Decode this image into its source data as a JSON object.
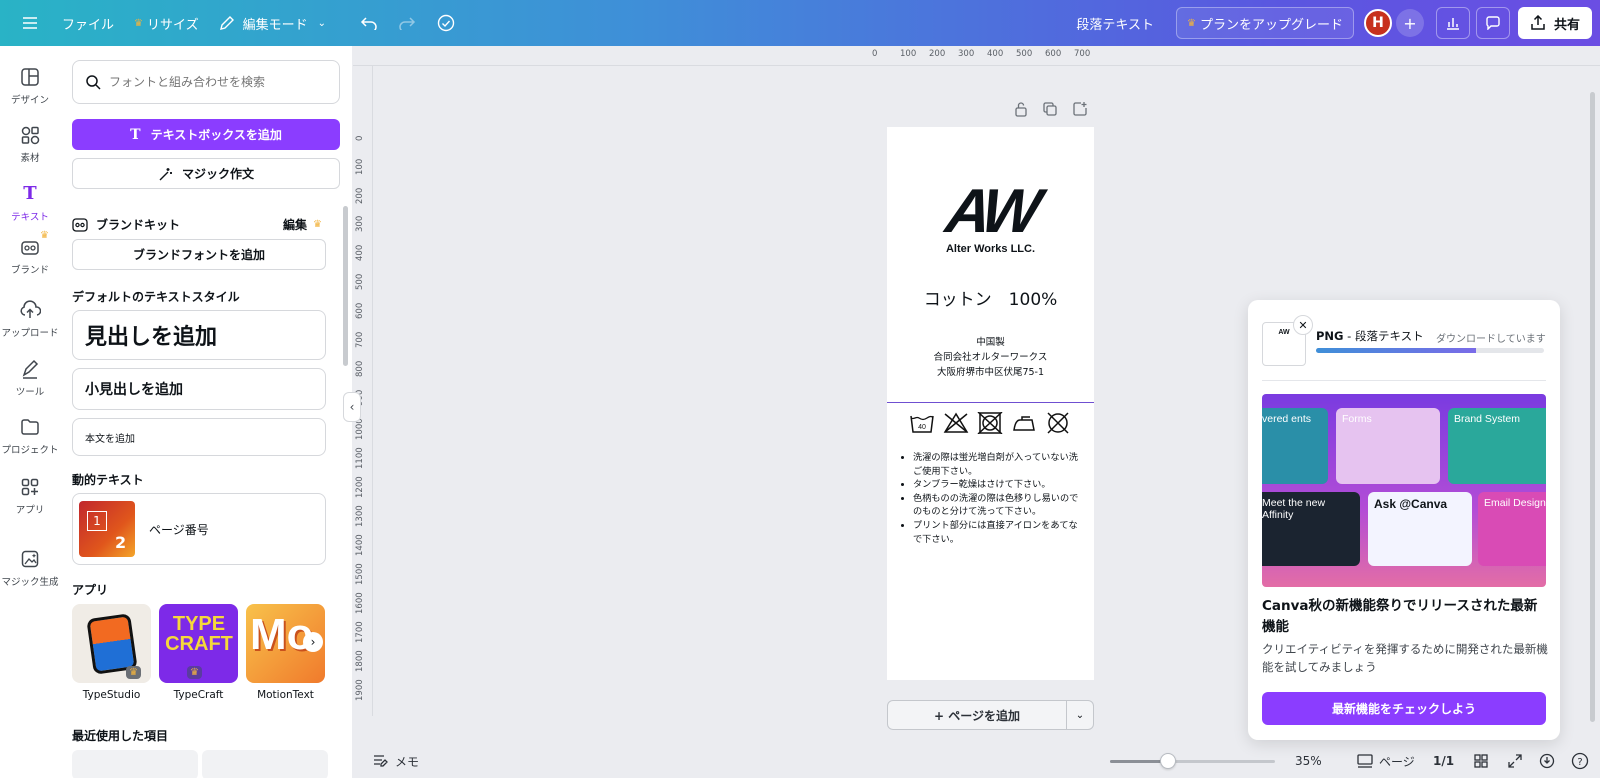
{
  "topbar": {
    "file": "ファイル",
    "resize": "リサイズ",
    "edit_mode": "編集モード",
    "doc_title": "段落テキスト",
    "upgrade": "プランをアップグレード",
    "avatar_initial": "H",
    "share": "共有",
    "brand_gradient_start": "#29b3c6",
    "brand_gradient_end": "#6b4ee3"
  },
  "rail": {
    "items": [
      {
        "label": "デザイン",
        "icon": "layout-icon"
      },
      {
        "label": "素材",
        "icon": "elements-icon"
      },
      {
        "label": "テキスト",
        "icon": "text-icon",
        "active": true
      },
      {
        "label": "ブランド",
        "icon": "brand-icon"
      },
      {
        "label": "アップロード",
        "icon": "upload-icon"
      },
      {
        "label": "ツール",
        "icon": "draw-icon"
      },
      {
        "label": "プロジェクト",
        "icon": "folder-icon"
      },
      {
        "label": "アプリ",
        "icon": "apps-icon"
      },
      {
        "label": "マジック生成",
        "icon": "magic-media-icon"
      }
    ]
  },
  "panel": {
    "search_placeholder": "フォントと組み合わせを検索",
    "add_textbox": "テキストボックスを追加",
    "magic_write": "マジック作文",
    "brand_kit": "ブランドキット",
    "brand_edit": "編集",
    "add_brand_font": "ブランドフォントを追加",
    "default_styles_title": "デフォルトのテキストスタイル",
    "heading": "見出しを追加",
    "subheading": "小見出しを追加",
    "body": "本文を追加",
    "dynamic_title": "動的テキスト",
    "page_number": "ページ番号",
    "apps_title": "アプリ",
    "apps": [
      {
        "name": "TypeStudio"
      },
      {
        "name": "TypeCraft"
      },
      {
        "name": "MotionText"
      }
    ],
    "recent_title": "最近使用した項目",
    "accent": "#8b3dff"
  },
  "ruler": {
    "top": [
      "0",
      "100",
      "200",
      "300",
      "400",
      "500",
      "600",
      "700"
    ],
    "left": [
      "0",
      "100",
      "200",
      "300",
      "400",
      "500",
      "600",
      "700",
      "800",
      "900",
      "1000",
      "1100",
      "1200",
      "1300",
      "1400",
      "1500",
      "1600",
      "1700",
      "1800",
      "1900"
    ]
  },
  "label_design": {
    "logo": "AW",
    "company": "Alter Works LLC.",
    "material": "コットン　100%",
    "origin_lines": [
      "中国製",
      "合同会社オルターワークス",
      "大阪府堺市中区伏尾75-1"
    ],
    "care_icons": [
      "wash-40-icon",
      "no-bleach-icon",
      "no-tumble-dry-icon",
      "iron-icon",
      "no-dry-clean-icon"
    ],
    "wash_temp": "40",
    "notes": [
      "洗濯の際は蛍光増白剤が入っていない洗ご使用下さい。",
      "タンブラー乾燥はさけて下さい。",
      "色柄ものの洗濯の際は色移りし易いのでのものと分けて洗って下さい。",
      "プリント部分には直接アイロンをあてなで下さい。"
    ]
  },
  "canvas": {
    "add_page": "+ ページを追加"
  },
  "bottombar": {
    "notes": "メモ",
    "zoom": "35%",
    "zoom_fraction": 0.35,
    "pages": "ページ",
    "page_count": "1/1"
  },
  "popup": {
    "format": "PNG",
    "doc_name": "- 段落テキスト",
    "status": "ダウンロードしています",
    "progress": 0.7,
    "promo_tiles": [
      "vered ents",
      "Forms",
      "Brand System",
      "Meet the new Affinity",
      "Ask @Canva",
      "Email Design"
    ],
    "headline": "Canva秋の新機能祭りでリリースされた最新機能",
    "body": "クリエイティビティを発揮するために開発された最新機能を試してみましょう",
    "cta": "最新機能をチェックしよう"
  }
}
